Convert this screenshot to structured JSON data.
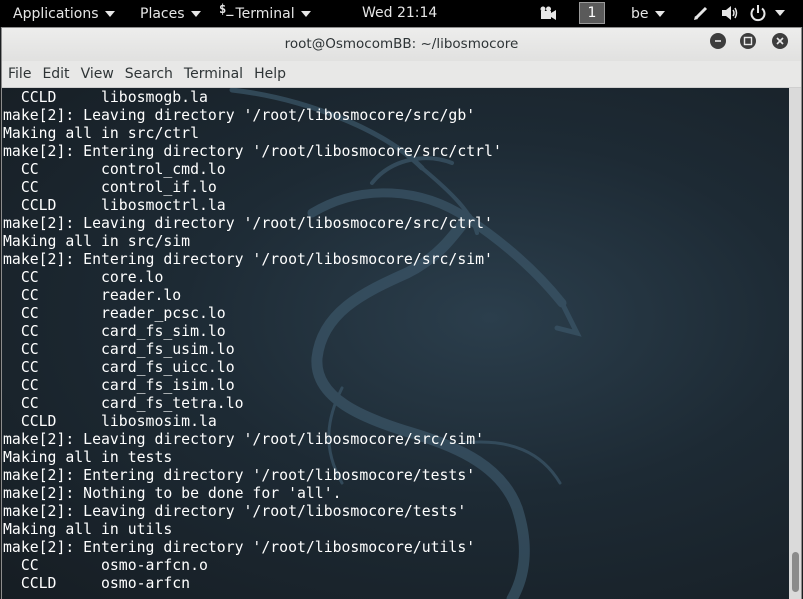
{
  "panel": {
    "applications": "Applications",
    "places": "Places",
    "terminal_icon": "$_",
    "terminal": "Terminal",
    "clock": "Wed 21:14",
    "workspace": "1",
    "keyboard_layout": "be",
    "icons": [
      "video-icon",
      "pen-icon",
      "volume-icon",
      "power-icon"
    ]
  },
  "window": {
    "title": "root@OsmocomBB: ~/libosmocore",
    "menu": [
      "File",
      "Edit",
      "View",
      "Search",
      "Terminal",
      "Help"
    ]
  },
  "terminal": {
    "text_color": "#ffffff",
    "lines": [
      "  CCLD     libosmogb.la",
      "make[2]: Leaving directory '/root/libosmocore/src/gb'",
      "Making all in src/ctrl",
      "make[2]: Entering directory '/root/libosmocore/src/ctrl'",
      "  CC       control_cmd.lo",
      "  CC       control_if.lo",
      "  CCLD     libosmoctrl.la",
      "make[2]: Leaving directory '/root/libosmocore/src/ctrl'",
      "Making all in src/sim",
      "make[2]: Entering directory '/root/libosmocore/src/sim'",
      "  CC       core.lo",
      "  CC       reader.lo",
      "  CC       reader_pcsc.lo",
      "  CC       card_fs_sim.lo",
      "  CC       card_fs_usim.lo",
      "  CC       card_fs_uicc.lo",
      "  CC       card_fs_isim.lo",
      "  CC       card_fs_tetra.lo",
      "  CCLD     libosmosim.la",
      "make[2]: Leaving directory '/root/libosmocore/src/sim'",
      "Making all in tests",
      "make[2]: Entering directory '/root/libosmocore/tests'",
      "make[2]: Nothing to be done for 'all'.",
      "make[2]: Leaving directory '/root/libosmocore/tests'",
      "Making all in utils",
      "make[2]: Entering directory '/root/libosmocore/utils'",
      "  CC       osmo-arfcn.o",
      "  CCLD     osmo-arfcn"
    ]
  }
}
